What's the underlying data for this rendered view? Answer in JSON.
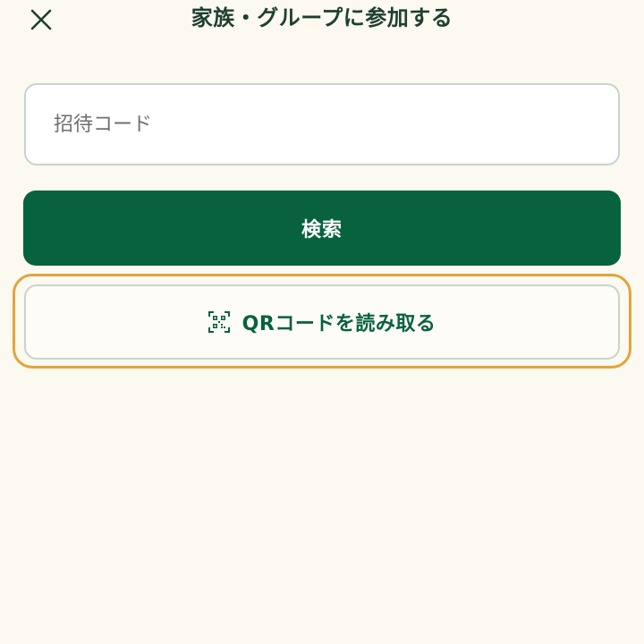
{
  "header": {
    "title": "家族・グループに参加する",
    "close_icon": "close-icon"
  },
  "form": {
    "invite_code_placeholder": "招待コード",
    "invite_code_value": "",
    "search_label": "検索",
    "qr_label": "QRコードを読み取る",
    "qr_icon": "qr-code-icon"
  },
  "colors": {
    "background": "#FBF9F0",
    "primary": "#07623D",
    "title_text": "#1E3F2F",
    "input_border": "#C7D5C9",
    "focus_ring": "#E2A43A"
  }
}
